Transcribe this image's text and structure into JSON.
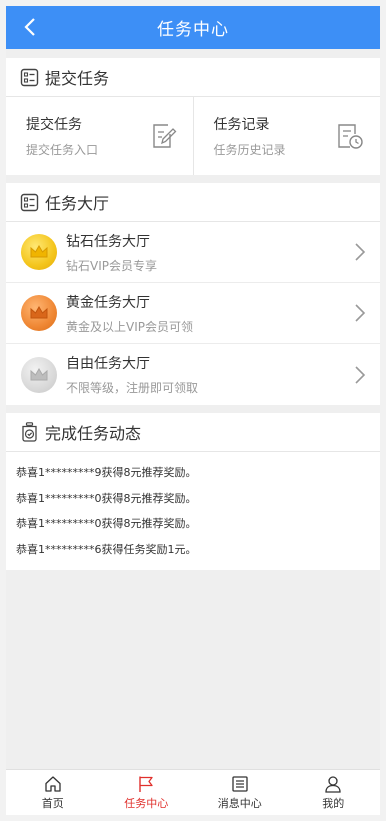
{
  "header": {
    "title": "任务中心",
    "back_icon": "chevron-left-icon"
  },
  "submit_section": {
    "title": "提交任务",
    "icon": "checklist-icon",
    "cells": [
      {
        "title": "提交任务",
        "subtitle": "提交任务入口",
        "icon": "edit-document-icon"
      },
      {
        "title": "任务记录",
        "subtitle": "任务历史记录",
        "icon": "history-document-icon"
      }
    ]
  },
  "hall_section": {
    "title": "任务大厅",
    "icon": "checklist-icon",
    "items": [
      {
        "title": "钻石任务大厅",
        "subtitle": "钻石VIP会员专享",
        "medal": "diamond-crown-icon",
        "color": "#f4c51c"
      },
      {
        "title": "黄金任务大厅",
        "subtitle": "黄金及以上VIP会员可领",
        "medal": "gold-crown-icon",
        "color": "#ef8734"
      },
      {
        "title": "自由任务大厅",
        "subtitle": "不限等级，注册即可领取",
        "medal": "free-crown-icon",
        "color": "#d9d9d9"
      }
    ]
  },
  "feed_section": {
    "title": "完成任务动态",
    "icon": "stopwatch-icon",
    "items": [
      "恭喜1*********9获得8元推荐奖励。",
      "恭喜1*********0获得8元推荐奖励。",
      "恭喜1*********0获得8元推荐奖励。",
      "恭喜1*********6获得任务奖励1元。"
    ]
  },
  "tabbar": {
    "active_color": "#e0302c",
    "tabs": [
      {
        "label": "首页",
        "icon": "home-icon",
        "active": false
      },
      {
        "label": "任务中心",
        "icon": "flag-icon",
        "active": true
      },
      {
        "label": "消息中心",
        "icon": "message-list-icon",
        "active": false
      },
      {
        "label": "我的",
        "icon": "user-icon",
        "active": false
      }
    ]
  },
  "colors": {
    "header_bg": "#3d8ff6",
    "page_bg": "#efefef"
  }
}
